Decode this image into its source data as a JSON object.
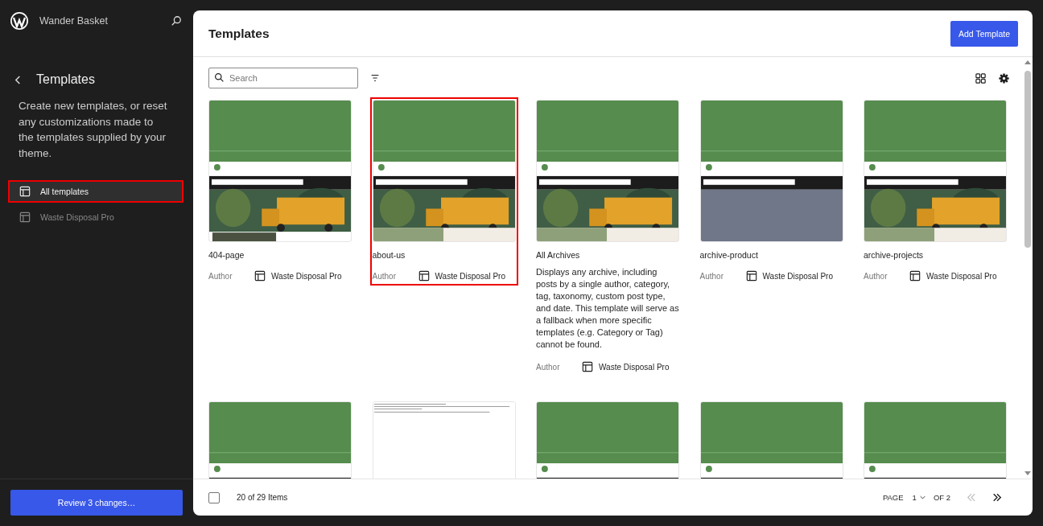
{
  "site": {
    "title": "Wander Basket"
  },
  "sidebar": {
    "heading": "Templates",
    "description": "Create new templates, or reset any customizations made to the templates supplied by your theme.",
    "items": [
      {
        "label": "All templates",
        "selected": true,
        "outlined": true
      },
      {
        "label": "Waste Disposal Pro",
        "selected": false,
        "outlined": false
      }
    ],
    "review_button": "Review 3 changes…"
  },
  "main": {
    "title": "Templates",
    "add_button": "Add Template",
    "search": {
      "placeholder": "Search"
    },
    "cards": [
      {
        "kind": "site",
        "name": "404-page",
        "author": "Author",
        "theme": "Waste Disposal Pro",
        "outlined": false
      },
      {
        "kind": "site",
        "name": "about-us",
        "author": "Author",
        "theme": "Waste Disposal Pro",
        "outlined": true
      },
      {
        "kind": "site",
        "name": "All Archives",
        "description": "Displays any archive, including posts by a single author, category, tag, taxonomy, custom post type, and date. This template will serve as a fallback when more specific templates (e.g. Category or Tag) cannot be found.",
        "author": "Author",
        "theme": "Waste Disposal Pro",
        "outlined": false
      },
      {
        "kind": "site",
        "name": "archive-product",
        "author": "Author",
        "theme": "Waste Disposal Pro",
        "outlined": false
      },
      {
        "kind": "site",
        "name": "archive-projects",
        "author": "Author",
        "theme": "Waste Disposal Pro",
        "outlined": false
      },
      {
        "kind": "site"
      },
      {
        "kind": "document"
      },
      {
        "kind": "site"
      },
      {
        "kind": "site"
      },
      {
        "kind": "site"
      }
    ],
    "footer": {
      "select_all_checked": false,
      "count": "20 of 29 Items",
      "page_label": "PAGE",
      "page": "1",
      "of_pages": "OF 2",
      "prev_disabled": true,
      "next_disabled": false
    }
  }
}
